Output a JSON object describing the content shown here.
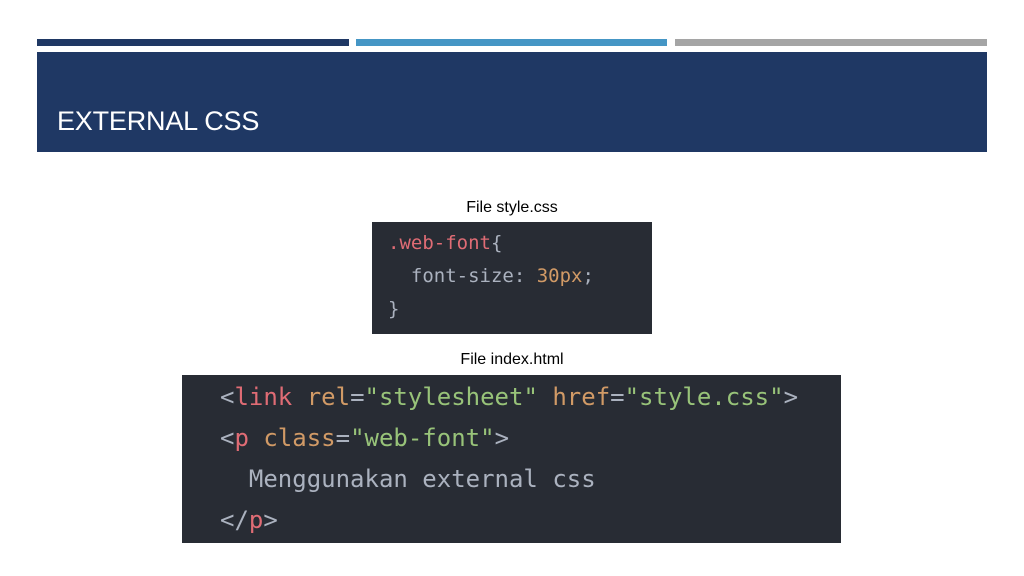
{
  "theme": {
    "accent_bar_1": "#1f3864",
    "accent_bar_2": "#4596c5",
    "accent_bar_3": "#a5a5a5",
    "title_band": "#1f3864",
    "code_bg": "#282c34",
    "code_text": "#abb2bf",
    "code_tag": "#e06c75",
    "code_attr": "#d19a66",
    "code_string": "#98c379",
    "code_punct": "#abb2bf"
  },
  "slide": {
    "title": "EXTERNAL CSS"
  },
  "css_file": {
    "caption": "File style.css",
    "lines": [
      [
        {
          "t": ".web-font",
          "c": "code_tag"
        },
        {
          "t": "{",
          "c": "code_punct"
        }
      ],
      [
        {
          "t": "  font-size",
          "c": "code_text"
        },
        {
          "t": ": ",
          "c": "code_punct"
        },
        {
          "t": "30px",
          "c": "code_attr"
        },
        {
          "t": ";",
          "c": "code_punct"
        }
      ],
      [
        {
          "t": "}",
          "c": "code_punct"
        }
      ]
    ]
  },
  "html_file": {
    "caption": "File index.html",
    "lines": [
      [
        {
          "t": "<",
          "c": "code_punct"
        },
        {
          "t": "link",
          "c": "code_tag"
        },
        {
          "t": " ",
          "c": "code_text"
        },
        {
          "t": "rel",
          "c": "code_attr"
        },
        {
          "t": "=",
          "c": "code_punct"
        },
        {
          "t": "\"stylesheet\"",
          "c": "code_string"
        },
        {
          "t": " ",
          "c": "code_text"
        },
        {
          "t": "href",
          "c": "code_attr"
        },
        {
          "t": "=",
          "c": "code_punct"
        },
        {
          "t": "\"style.css\"",
          "c": "code_string"
        },
        {
          "t": ">",
          "c": "code_punct"
        }
      ],
      [
        {
          "t": "<",
          "c": "code_punct"
        },
        {
          "t": "p",
          "c": "code_tag"
        },
        {
          "t": " ",
          "c": "code_text"
        },
        {
          "t": "class",
          "c": "code_attr"
        },
        {
          "t": "=",
          "c": "code_punct"
        },
        {
          "t": "\"web-font\"",
          "c": "code_string"
        },
        {
          "t": ">",
          "c": "code_punct"
        }
      ],
      [
        {
          "t": "  Menggunakan external css",
          "c": "code_text"
        }
      ],
      [
        {
          "t": "</",
          "c": "code_punct"
        },
        {
          "t": "p",
          "c": "code_tag"
        },
        {
          "t": ">",
          "c": "code_punct"
        }
      ]
    ]
  }
}
